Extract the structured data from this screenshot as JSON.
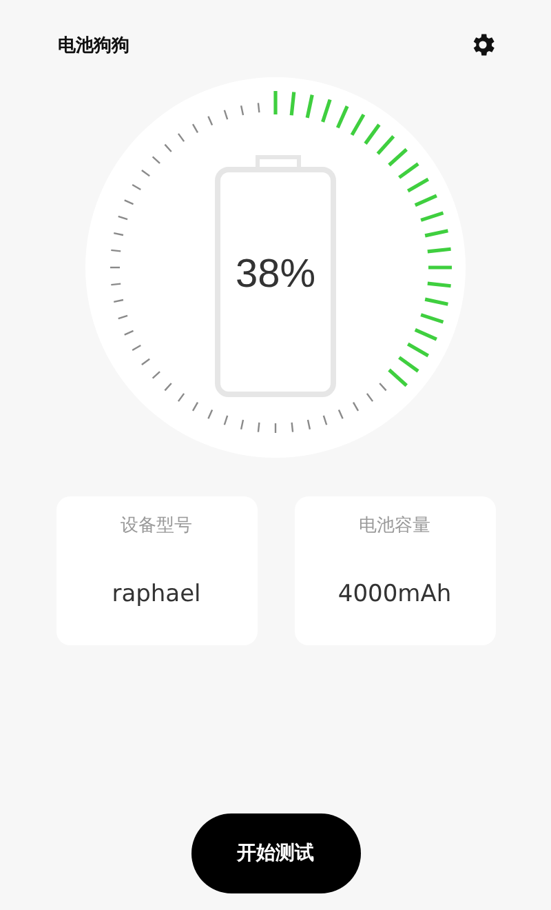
{
  "app_title": "电池狗狗",
  "battery": {
    "percent": "38%"
  },
  "info_cards": [
    {
      "label": "设备型号",
      "value": "raphael"
    },
    {
      "label": "电池容量",
      "value": "4000mAh"
    }
  ],
  "start_button": "开始测试"
}
